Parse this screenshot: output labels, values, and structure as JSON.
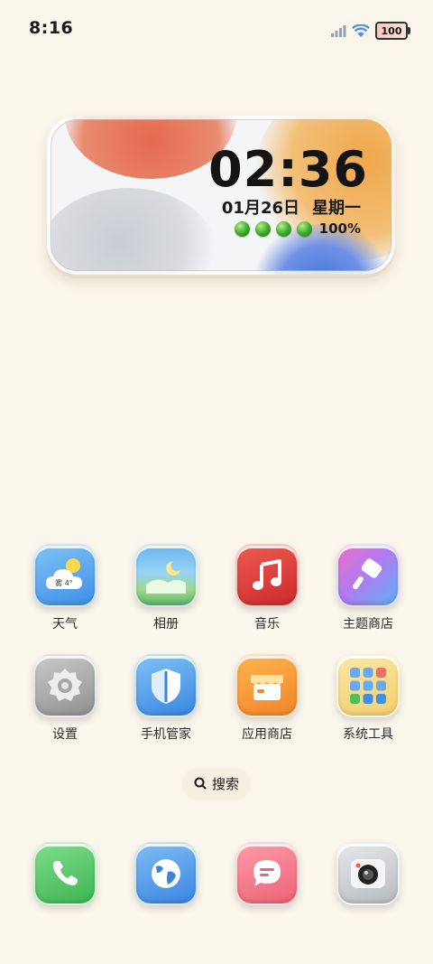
{
  "status_bar": {
    "time": "8:16",
    "battery": "100"
  },
  "widget": {
    "time": "02:36",
    "date": "01月26日",
    "weekday": "星期一",
    "battery": "100%"
  },
  "apps": [
    {
      "label": "天气",
      "weather_text": "雾 4°"
    },
    {
      "label": "相册"
    },
    {
      "label": "音乐"
    },
    {
      "label": "主题商店"
    },
    {
      "label": "设置"
    },
    {
      "label": "手机管家"
    },
    {
      "label": "应用商店"
    },
    {
      "label": "系统工具"
    }
  ],
  "search": {
    "label": "搜索"
  },
  "icons": [
    "signal-icon",
    "wifi-icon",
    "battery-icon",
    "search-icon",
    "phone-icon",
    "browser-icon",
    "message-icon",
    "camera-icon"
  ]
}
